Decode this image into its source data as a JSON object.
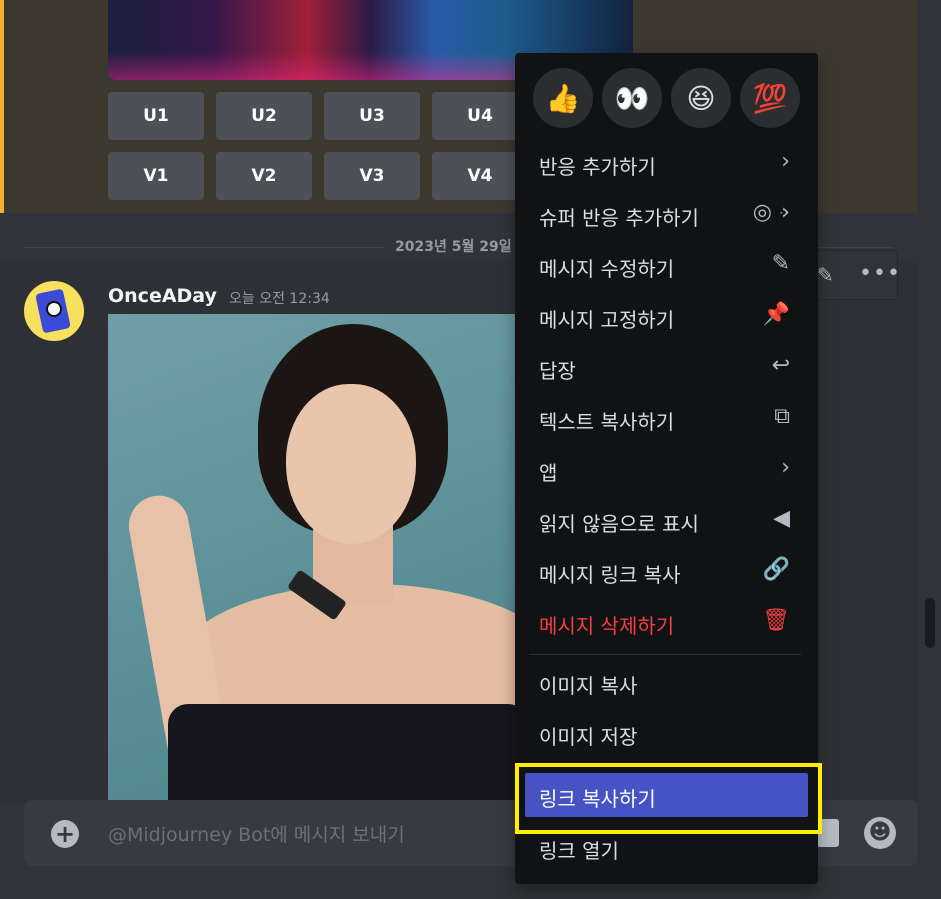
{
  "top_message": {
    "upscale_buttons": [
      "U1",
      "U2",
      "U3",
      "U4"
    ],
    "variation_buttons": [
      "V1",
      "V2",
      "V3",
      "V4"
    ]
  },
  "date_divider": "2023년 5월 29일",
  "message": {
    "username": "OnceADay",
    "timestamp": "오늘 오전 12:34",
    "hover_toolbar": {
      "edit_icon": "pencil-icon",
      "more_icon": "more-dots-icon"
    }
  },
  "composer": {
    "placeholder": "@Midjourney Bot에 메시지 보내기"
  },
  "context_menu": {
    "reactions": [
      "👍",
      "👀",
      "😆",
      "💯"
    ],
    "items": [
      {
        "label": "반응 추가하기",
        "icon": "chevron-right-icon"
      },
      {
        "label": "슈퍼 반응 추가하기",
        "icon": "super-reaction-icon"
      },
      {
        "label": "메시지 수정하기",
        "icon": "pencil-icon"
      },
      {
        "label": "메시지 고정하기",
        "icon": "pin-icon"
      },
      {
        "label": "답장",
        "icon": "reply-icon"
      },
      {
        "label": "텍스트 복사하기",
        "icon": "copy-icon"
      },
      {
        "label": "앱",
        "icon": "chevron-right-icon"
      },
      {
        "label": "읽지 않음으로 표시",
        "icon": "unread-flag-icon"
      },
      {
        "label": "메시지 링크 복사",
        "icon": "link-icon"
      },
      {
        "label": "메시지 삭제하기",
        "icon": "trash-icon"
      },
      {
        "label": "이미지 복사"
      },
      {
        "label": "이미지 저장"
      },
      {
        "label": "링크 복사하기"
      },
      {
        "label": "링크 열기"
      }
    ]
  },
  "colors": {
    "accent": "#4752c4",
    "danger": "#f23f43",
    "highlight": "#ffee00",
    "menu_bg": "#111214",
    "chat_bg": "#313338"
  }
}
